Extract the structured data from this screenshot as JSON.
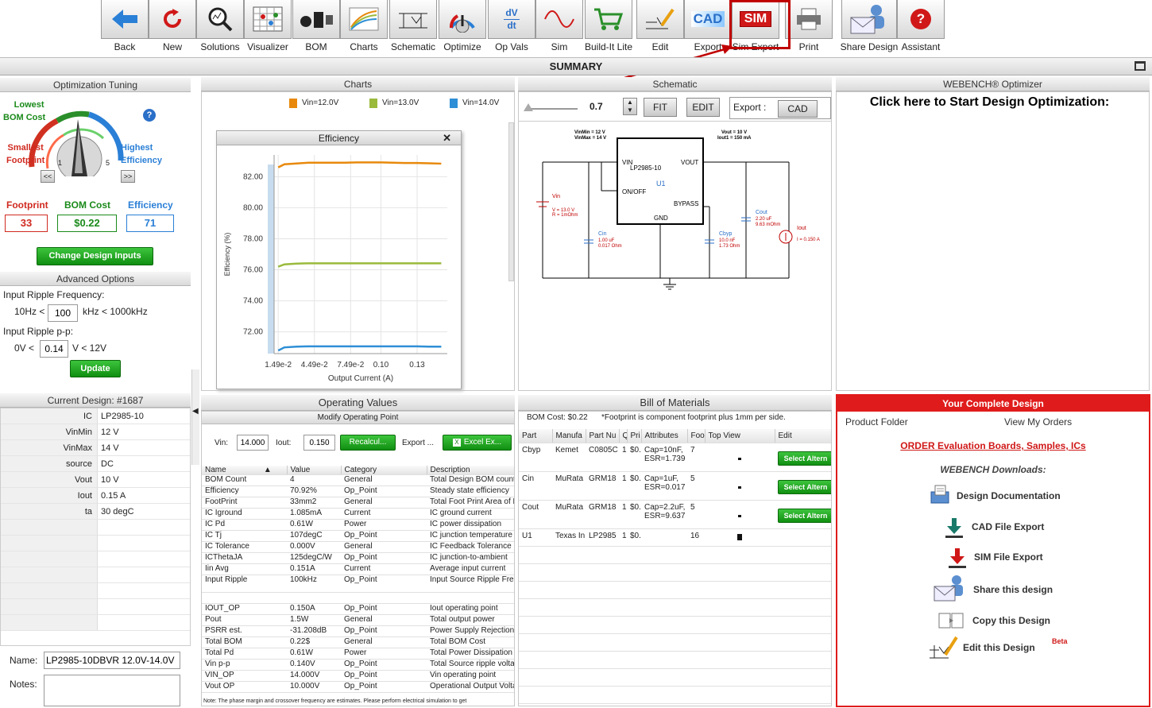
{
  "toolbar": {
    "items": [
      {
        "label": "Back",
        "icon": "back-arrow-icon"
      },
      {
        "label": "New",
        "icon": "refresh-icon"
      },
      {
        "label": "Solutions",
        "icon": "magnifier-icon"
      },
      {
        "label": "Visualizer",
        "icon": "visualizer-grid-icon"
      },
      {
        "label": "BOM",
        "icon": "components-icon"
      },
      {
        "label": "Charts",
        "icon": "chart-lines-icon"
      },
      {
        "label": "Schematic",
        "icon": "schematic-icon"
      },
      {
        "label": "Optimize",
        "icon": "dial-icon"
      },
      {
        "label": "Op Vals",
        "icon": "dv-dt-icon",
        "icon_text": "dV\ndt"
      },
      {
        "label": "Sim",
        "icon": "sine-wave-icon"
      },
      {
        "label": "Build-It Lite",
        "icon": "shopping-cart-icon"
      },
      {
        "label": "Edit",
        "icon": "edit-pencil-icon"
      },
      {
        "label": "Export",
        "icon": "cad-export-icon",
        "icon_text": "CAD"
      },
      {
        "label": "Sim Export",
        "icon": "sim-export-icon",
        "icon_text": "SIM"
      },
      {
        "label": "Print",
        "icon": "printer-icon"
      },
      {
        "label": "Share Design",
        "icon": "share-envelope-icon"
      },
      {
        "label": "Assistant",
        "icon": "help-icon",
        "icon_text": "?"
      }
    ]
  },
  "summary_title": "SUMMARY",
  "optimization": {
    "title": "Optimization Tuning",
    "lowest": "Lowest",
    "bom_cost": "BOM Cost",
    "smallest": "Smallest",
    "footprint_lbl": "Footprint",
    "highest": "Highest",
    "efficiency_lbl": "Efficiency",
    "knob_min": "1",
    "knob_max": "5",
    "prev": "<<",
    "next": ">>",
    "m_footprint_label": "Footprint",
    "m_footprint": "33",
    "m_bom_label": "BOM Cost",
    "m_bom": "$0.22",
    "m_eff_label": "Efficiency",
    "m_eff": "71",
    "change_inputs": "Change Design Inputs"
  },
  "advanced": {
    "title": "Advanced Options",
    "ripple_freq_label": "Input Ripple Frequency:",
    "freq_low": "10Hz <",
    "freq_val": "100",
    "freq_high": "kHz < 1000kHz",
    "ripple_pp_label": "Input Ripple p-p:",
    "pp_low": "0V <",
    "pp_val": "0.14",
    "pp_high": "V < 12V",
    "update": "Update"
  },
  "current_design": {
    "title": "Current Design: #1687",
    "rows": [
      {
        "k": "IC",
        "v": "LP2985-10"
      },
      {
        "k": "VinMin",
        "v": "12 V"
      },
      {
        "k": "VinMax",
        "v": "14 V"
      },
      {
        "k": "source",
        "v": "DC"
      },
      {
        "k": "Vout",
        "v": "10 V"
      },
      {
        "k": "Iout",
        "v": "0.15 A"
      },
      {
        "k": "ta",
        "v": "30 degC"
      }
    ],
    "name_label": "Name:",
    "name_value": "LP2985-10DBVR 12.0V-14.0V",
    "notes_label": "Notes:"
  },
  "charts": {
    "title": "Charts",
    "legend": [
      "Vin=12.0V",
      "Vin=13.0V",
      "Vin=14.0V"
    ],
    "window_title": "Efficiency",
    "close": "✕"
  },
  "chart_data": {
    "type": "line",
    "title": "Efficiency",
    "xlabel": "Output Current (A)",
    "ylabel": "Efficiency (%)",
    "x": [
      0.0149,
      0.02,
      0.03,
      0.04,
      0.05,
      0.06,
      0.07,
      0.08,
      0.09,
      0.1,
      0.11,
      0.12,
      0.13,
      0.14,
      0.15
    ],
    "xticks": [
      "1.49e-2",
      "4.49e-2",
      "7.49e-2",
      "0.10",
      "0.13"
    ],
    "xtick_values": [
      0.0149,
      0.0449,
      0.0749,
      0.1,
      0.13
    ],
    "yticks": [
      "72.00",
      "74.00",
      "76.00",
      "78.00",
      "80.00",
      "82.00"
    ],
    "ylim": [
      70.6,
      83.4
    ],
    "xlim": [
      0.0115,
      0.155
    ],
    "series": [
      {
        "name": "Vin=12.0V",
        "color": "#e8890c",
        "values": [
          82.6,
          82.8,
          82.85,
          82.9,
          82.9,
          82.9,
          82.9,
          82.92,
          82.92,
          82.92,
          82.9,
          82.88,
          82.88,
          82.86,
          82.84
        ]
      },
      {
        "name": "Vin=13.0V",
        "color": "#9aba3c",
        "values": [
          76.2,
          76.35,
          76.4,
          76.42,
          76.42,
          76.42,
          76.42,
          76.42,
          76.42,
          76.42,
          76.42,
          76.42,
          76.42,
          76.42,
          76.42
        ]
      },
      {
        "name": "Vin=14.0V",
        "color": "#2e8fd6",
        "values": [
          70.8,
          71.0,
          71.05,
          71.07,
          71.07,
          71.07,
          71.07,
          71.07,
          71.07,
          71.07,
          71.07,
          71.07,
          71.07,
          71.05,
          71.05
        ]
      }
    ]
  },
  "schematic": {
    "title": "Schematic",
    "zoom": "0.7",
    "fit": "FIT",
    "edit": "EDIT",
    "export_label": "Export :",
    "cad": "CAD",
    "vin_info1": "VinMin = 12 V",
    "vin_info2": "VinMax = 14 V",
    "vout_info1": "Vout = 10 V",
    "vout_info2": "Iout1 = 150 mA",
    "ic_name": "LP2985-10",
    "ic_ref": "U1",
    "pin_vin": "VIN",
    "pin_vout": "VOUT",
    "pin_onoff": "ON/OFF",
    "pin_bypass": "BYPASS",
    "pin_gnd": "GND",
    "src_name": "Vin",
    "src_v": "V = 13.0 V",
    "src_r": "R = 1mOhm",
    "cin": "Cin",
    "cin_v": "1.00 uF",
    "cin_r": "0.017 Ohm",
    "cbyp": "Cbyp",
    "cbyp_v": "10.0 nF",
    "cbyp_r": "1.73 Ohm",
    "cout": "Cout",
    "cout_v": "2.20 uF",
    "cout_r": "9.63 mOhm",
    "iout": "Iout",
    "iout_v": "I = 0.150 A"
  },
  "optimizer": {
    "title": "WEBENCH® Optimizer",
    "cta": "Click here to Start Design Optimization:"
  },
  "opvals": {
    "title": "Operating Values",
    "subtitle": "Modify Operating Point",
    "vin_label": "Vin:",
    "vin_val": "14.000",
    "iout_label": "Iout:",
    "iout_val": "0.150",
    "recalc": "Recalcul...",
    "export": "Export ...",
    "excel": "Excel Ex...",
    "headers": [
      "Name",
      "Value",
      "Category",
      "Description"
    ],
    "rows": [
      [
        "BOM Count",
        "4",
        "General",
        "Total Design BOM count"
      ],
      [
        "Efficiency",
        "70.92%",
        "Op_Point",
        "Steady state efficiency"
      ],
      [
        "FootPrint",
        "33mm2",
        "General",
        "Total Foot Print Area of BOM"
      ],
      [
        "IC Iground",
        "1.085mA",
        "Current",
        "IC ground current"
      ],
      [
        "IC Pd",
        "0.61W",
        "Power",
        "IC power dissipation"
      ],
      [
        "IC Tj",
        "107degC",
        "Op_Point",
        "IC junction temperature"
      ],
      [
        "IC Tolerance",
        "0.000V",
        "General",
        "IC Feedback Tolerance"
      ],
      [
        "ICThetaJA",
        "125degC/W",
        "Op_Point",
        "IC junction-to-ambient"
      ],
      [
        "Iin Avg",
        "0.151A",
        "Current",
        "Average input current"
      ],
      [
        "Input Ripple",
        "100kHz",
        "Op_Point",
        "Input Source Ripple Freq"
      ],
      [
        "",
        "",
        " ",
        ""
      ],
      [
        "IOUT_OP",
        "0.150A",
        "Op_Point",
        "Iout operating point"
      ],
      [
        "Pout",
        "1.5W",
        "General",
        "Total output power"
      ],
      [
        "PSRR est.",
        "-31.208dB",
        "Op_Point",
        "Power Supply Rejection"
      ],
      [
        "Total BOM",
        "0.22$",
        "General",
        "Total BOM Cost"
      ],
      [
        "Total Pd",
        "0.61W",
        "Power",
        "Total Power Dissipation"
      ],
      [
        "Vin p-p",
        "0.140V",
        "Op_Point",
        "Total Source ripple voltage"
      ],
      [
        "VIN_OP",
        "14.000V",
        "Op_Point",
        "Vin operating point"
      ],
      [
        "Vout OP",
        "10.000V",
        "Op_Point",
        "Operational Output Voltage"
      ]
    ],
    "note": "Note: The phase margin and crossover frequency are estimates.  Please perform electrical simulation to get"
  },
  "bom": {
    "title": "Bill of Materials",
    "cost": "BOM Cost: $0.22",
    "note": "*Footprint is component footprint plus 1mm per side.",
    "headers": [
      "Part",
      "Manufa",
      "Part Nu",
      "Qu",
      "Pri",
      "Attributes",
      "Foo",
      "Top View",
      "Edit"
    ],
    "rows": [
      {
        "part": "Cbyp",
        "mfr": "Kemet",
        "pn": "C0805C",
        "qty": "1",
        "price": "$0.",
        "attr1": "Cap=10nF,",
        "attr2": "ESR=1.739",
        "fp": "7",
        "edit": "Select Altern"
      },
      {
        "part": "Cin",
        "mfr": "MuRata",
        "pn": "GRM18",
        "qty": "1",
        "price": "$0.",
        "attr1": "Cap=1uF,",
        "attr2": "ESR=0.017",
        "fp": "5",
        "edit": "Select Altern"
      },
      {
        "part": "Cout",
        "mfr": "MuRata",
        "pn": "GRM18",
        "qty": "1",
        "price": "$0.",
        "attr1": "Cap=2.2uF,",
        "attr2": "ESR=9.637",
        "fp": "5",
        "edit": "Select Altern"
      },
      {
        "part": "U1",
        "mfr": "Texas In",
        "pn": "LP2985",
        "qty": "1",
        "price": "$0.",
        "attr1": "",
        "attr2": "",
        "fp": "16",
        "edit": ""
      }
    ]
  },
  "complete": {
    "title": "Your Complete Design",
    "product_folder": "Product Folder",
    "view_orders": "View My Orders",
    "order_link": "ORDER Evaluation Boards, Samples, ICs",
    "downloads": "WEBENCH Downloads:",
    "items": [
      {
        "label": "Design Documentation",
        "icon": "documentation-icon"
      },
      {
        "label": "CAD File Export",
        "icon": "cad-download-icon"
      },
      {
        "label": "SIM File Export",
        "icon": "sim-download-icon"
      },
      {
        "label": "Share this design",
        "icon": "share-envelope-icon"
      },
      {
        "label": "Copy this Design",
        "icon": "copy-pages-icon"
      },
      {
        "label": "Edit this Design",
        "icon": "edit-schematic-icon"
      }
    ],
    "beta": "Beta"
  }
}
